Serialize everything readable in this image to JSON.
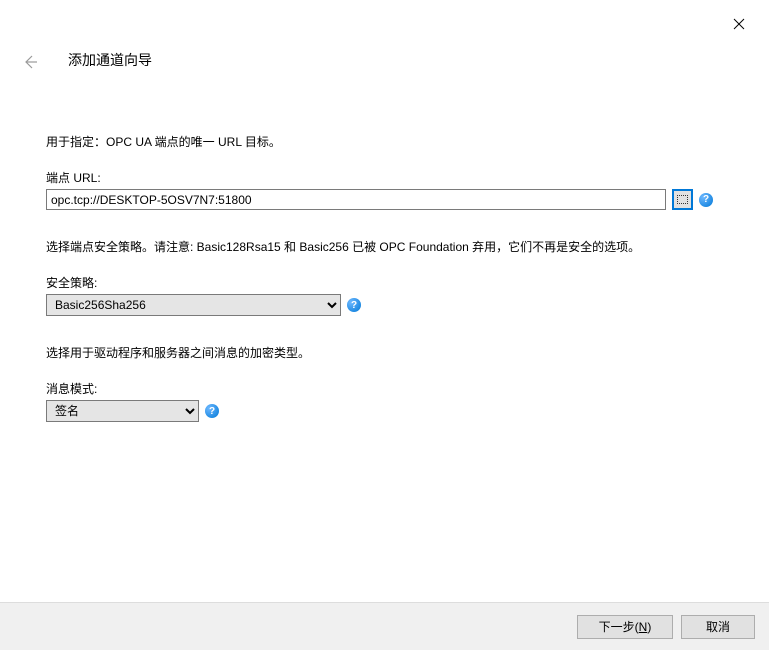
{
  "header": {
    "title": "添加通道向导"
  },
  "section1": {
    "desc": "用于指定：OPC UA 端点的唯一 URL 目标。",
    "label": "端点 URL:",
    "value": "opc.tcp://DESKTOP-5OSV7N7:51800"
  },
  "section2": {
    "desc": "选择端点安全策略。请注意: Basic128Rsa15 和 Basic256 已被 OPC Foundation 弃用，它们不再是安全的选项。",
    "label": "安全策略:",
    "value": "Basic256Sha256"
  },
  "section3": {
    "desc": "选择用于驱动程序和服务器之间消息的加密类型。",
    "label": "消息模式:",
    "value": "签名"
  },
  "buttons": {
    "next_prefix": "下一步(",
    "next_key": "N",
    "next_suffix": ")",
    "cancel": "取消"
  },
  "help": {
    "symbol": "?"
  }
}
